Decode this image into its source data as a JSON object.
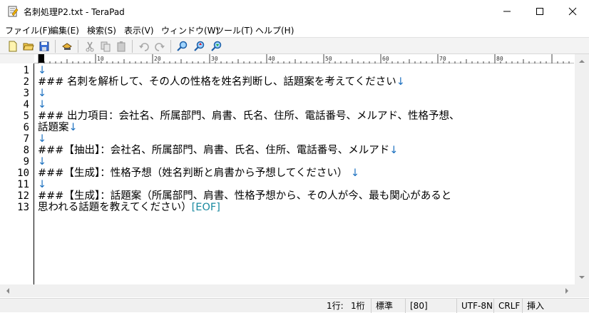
{
  "window": {
    "title": "名刺処理P2.txt - TeraPad"
  },
  "menu": [
    {
      "label": "ファイル(F)"
    },
    {
      "label": "編集(E)"
    },
    {
      "label": "検索(S)"
    },
    {
      "label": "表示(V)"
    },
    {
      "label": "ウィンドウ(W)"
    },
    {
      "label": "ツール(T)"
    },
    {
      "label": "ヘルプ(H)"
    }
  ],
  "toolbar": {
    "icons": [
      "new-file-icon",
      "open-folder-icon",
      "save-icon",
      "print-icon",
      "cut-icon",
      "copy-icon",
      "paste-icon",
      "undo-icon",
      "redo-icon",
      "find-icon",
      "find-next-icon",
      "find-prev-icon"
    ]
  },
  "ruler": {
    "marks": [
      "0",
      "10",
      "20",
      "30",
      "40",
      "50",
      "60",
      "70",
      "80"
    ]
  },
  "editor": {
    "line_numbers": [
      "1",
      "2",
      "3",
      "4",
      "5",
      "6",
      "7",
      "8",
      "9",
      "10",
      "11",
      "12",
      "13"
    ],
    "lines": [
      {
        "text": "",
        "mark": "↓"
      },
      {
        "text": "### 名刺を解析して、その人の性格を姓名判断し、話題案を考えてください",
        "mark": "↓"
      },
      {
        "text": "",
        "mark": "↓"
      },
      {
        "text": "",
        "mark": "↓"
      },
      {
        "text": "### 出力項目：会社名、所属部門、肩書、氏名、住所、電話番号、メルアド、性格予想、",
        "mark": ""
      },
      {
        "text": "話題案",
        "mark": "↓"
      },
      {
        "text": "",
        "mark": "↓"
      },
      {
        "text": "###【抽出】：会社名、所属部門、肩書、氏名、住所、電話番号、メルアド",
        "mark": "↓"
      },
      {
        "text": "",
        "mark": "↓"
      },
      {
        "text": "###【生成】：性格予想（姓名判断と肩書から予想してください）",
        "mark": " ↓"
      },
      {
        "text": "",
        "mark": "↓"
      },
      {
        "text": "###【生成】：話題案（所属部門、肩書、性格予想から、その人が今、最も関心があると",
        "mark": ""
      },
      {
        "text": "思われる話題を教えてください）",
        "mark": "[EOF]"
      }
    ]
  },
  "status": {
    "line": "1行:",
    "col": "1桁",
    "mode": "標準",
    "width": "[80]",
    "encoding": "UTF-8N",
    "newline": "CRLF",
    "insert": "挿入"
  },
  "colors": {
    "marker": "#1a6fbf",
    "eof": "#1a8aa0"
  }
}
